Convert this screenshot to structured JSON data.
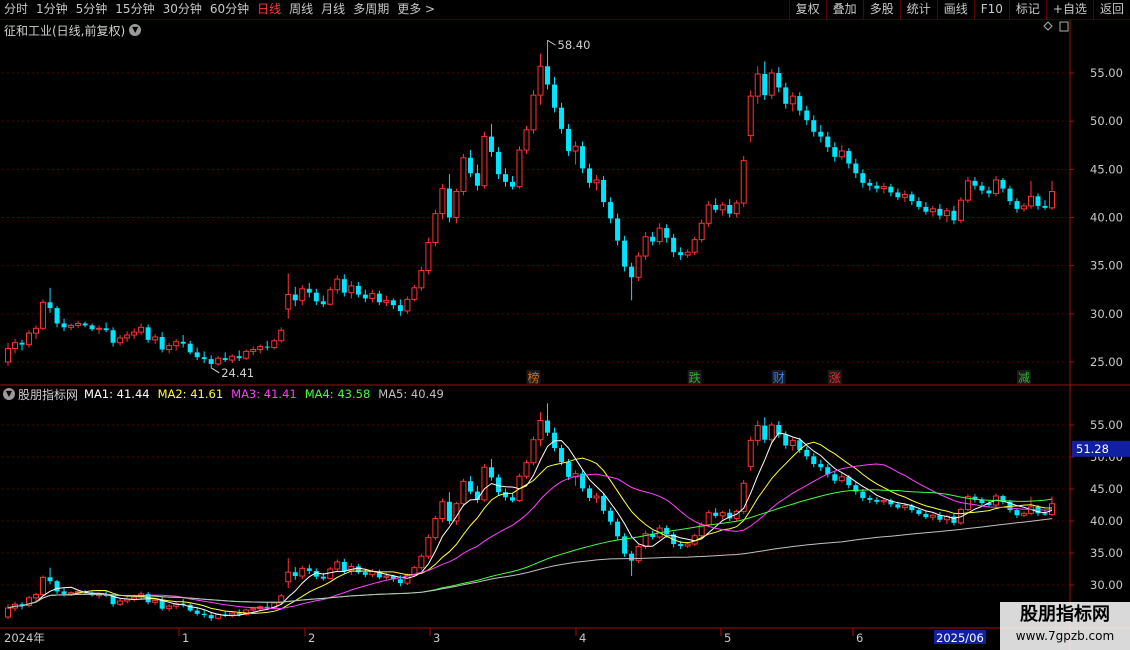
{
  "toolbar": {
    "left": [
      "分时",
      "1分钟",
      "5分钟",
      "15分钟",
      "30分钟",
      "60分钟",
      "日线",
      "周线",
      "月线",
      "多周期",
      "更多 >"
    ],
    "active": "日线",
    "right": [
      "复权",
      "叠加",
      "多股",
      "统计",
      "画线",
      "F10",
      "标记",
      "+自选",
      "返回"
    ]
  },
  "main_panel": {
    "title": "征和工业(日线,前复权)",
    "events": [
      "榜",
      "跌",
      "财",
      "涨",
      "减"
    ]
  },
  "indicator_panel": {
    "name": "股朋指标网",
    "ma": [
      {
        "label": "MA1: 41.44",
        "color": "#ffffff"
      },
      {
        "label": "MA2: 41.61",
        "color": "#ffff40"
      },
      {
        "label": "MA3: 41.41",
        "color": "#ff40ff"
      },
      {
        "label": "MA4: 43.58",
        "color": "#40ff40"
      },
      {
        "label": "MA5: 40.49",
        "color": "#c0c0c0"
      }
    ],
    "current_price_tag": "51.28"
  },
  "colors": {
    "up": "#ff3232",
    "down": "#00e5ff",
    "grid": "#5a0000",
    "axis": "#a01010"
  },
  "watermark": {
    "line1": "股朋指标网",
    "line2": "www.7gpzb.com"
  },
  "chart_data": {
    "type": "candlestick",
    "y_ticks_main": [
      "25.00",
      "30.00",
      "35.00",
      "40.00",
      "45.00",
      "50.00",
      "55.00"
    ],
    "y_ticks_ind": [
      "30.00",
      "35.00",
      "40.00",
      "45.00",
      "50.00",
      "55.00"
    ],
    "x_labels": [
      "2024年",
      "1",
      "2",
      "3",
      "4",
      "5",
      "6",
      "2025/06"
    ],
    "max_label": "58.40",
    "min_label": "24.41",
    "ohlc": [
      [
        25.0,
        27.0,
        24.6,
        26.4
      ],
      [
        26.4,
        27.4,
        25.9,
        27.0
      ],
      [
        27.0,
        27.3,
        26.2,
        26.8
      ],
      [
        26.8,
        28.3,
        26.5,
        28.0
      ],
      [
        28.0,
        28.8,
        27.4,
        28.5
      ],
      [
        28.5,
        31.5,
        28.3,
        31.2
      ],
      [
        31.2,
        32.7,
        30.1,
        30.6
      ],
      [
        30.6,
        30.8,
        28.6,
        29.0
      ],
      [
        29.0,
        29.5,
        28.2,
        28.6
      ],
      [
        28.6,
        29.0,
        28.3,
        28.8
      ],
      [
        28.8,
        29.3,
        28.5,
        29.0
      ],
      [
        29.0,
        29.2,
        28.6,
        28.8
      ],
      [
        28.8,
        29.0,
        28.2,
        28.4
      ],
      [
        28.4,
        28.8,
        27.9,
        28.5
      ],
      [
        28.5,
        29.1,
        28.1,
        28.3
      ],
      [
        28.3,
        28.6,
        26.6,
        27.0
      ],
      [
        27.0,
        27.8,
        26.7,
        27.5
      ],
      [
        27.5,
        28.2,
        27.1,
        27.8
      ],
      [
        27.8,
        28.5,
        27.4,
        28.1
      ],
      [
        28.1,
        29.0,
        27.8,
        28.6
      ],
      [
        28.6,
        28.9,
        27.0,
        27.3
      ],
      [
        27.3,
        27.9,
        26.9,
        27.6
      ],
      [
        27.6,
        28.1,
        26.0,
        26.3
      ],
      [
        26.3,
        27.0,
        25.9,
        26.7
      ],
      [
        26.7,
        27.4,
        26.2,
        27.1
      ],
      [
        27.1,
        27.8,
        26.5,
        26.9
      ],
      [
        26.9,
        27.2,
        25.8,
        26.0
      ],
      [
        26.0,
        26.5,
        25.2,
        25.5
      ],
      [
        25.5,
        26.1,
        24.9,
        25.3
      ],
      [
        25.3,
        25.7,
        24.4,
        24.8
      ],
      [
        24.8,
        25.6,
        24.6,
        25.4
      ],
      [
        25.4,
        26.0,
        25.0,
        25.2
      ],
      [
        25.2,
        25.8,
        24.9,
        25.6
      ],
      [
        25.6,
        26.2,
        25.1,
        25.4
      ],
      [
        25.4,
        26.3,
        25.2,
        26.1
      ],
      [
        26.1,
        26.6,
        25.7,
        26.3
      ],
      [
        26.3,
        26.8,
        25.9,
        26.6
      ],
      [
        26.6,
        27.2,
        26.2,
        26.5
      ],
      [
        26.5,
        27.4,
        26.3,
        27.2
      ],
      [
        27.2,
        28.6,
        27.0,
        28.3
      ],
      [
        30.5,
        34.2,
        29.5,
        32.0
      ],
      [
        32.0,
        32.8,
        30.8,
        31.4
      ],
      [
        31.4,
        33.0,
        30.9,
        32.6
      ],
      [
        32.6,
        33.2,
        31.7,
        32.2
      ],
      [
        32.2,
        32.6,
        30.9,
        31.3
      ],
      [
        31.3,
        31.9,
        30.7,
        31.0
      ],
      [
        31.0,
        32.8,
        30.9,
        32.5
      ],
      [
        32.5,
        34.0,
        32.1,
        33.6
      ],
      [
        33.6,
        34.1,
        31.8,
        32.2
      ],
      [
        32.2,
        33.4,
        31.6,
        32.9
      ],
      [
        32.9,
        33.3,
        31.7,
        32.0
      ],
      [
        32.0,
        32.5,
        31.2,
        31.6
      ],
      [
        31.6,
        32.5,
        31.2,
        32.1
      ],
      [
        32.1,
        32.4,
        30.9,
        31.2
      ],
      [
        31.2,
        31.9,
        30.8,
        31.4
      ],
      [
        31.4,
        31.6,
        30.5,
        30.9
      ],
      [
        30.9,
        31.5,
        29.8,
        30.3
      ],
      [
        30.3,
        31.8,
        30.0,
        31.5
      ],
      [
        31.5,
        33.0,
        31.3,
        32.7
      ],
      [
        32.7,
        34.9,
        32.4,
        34.5
      ],
      [
        34.5,
        37.9,
        34.1,
        37.4
      ],
      [
        37.4,
        40.8,
        37.0,
        40.4
      ],
      [
        40.4,
        43.5,
        39.8,
        43.0
      ],
      [
        43.0,
        44.5,
        39.5,
        40.0
      ],
      [
        40.0,
        43.0,
        39.4,
        42.7
      ],
      [
        42.7,
        46.6,
        42.3,
        46.2
      ],
      [
        46.2,
        47.0,
        44.2,
        44.6
      ],
      [
        44.6,
        45.5,
        42.8,
        43.3
      ],
      [
        43.3,
        48.9,
        43.0,
        48.4
      ],
      [
        48.4,
        49.7,
        46.3,
        46.8
      ],
      [
        46.8,
        47.3,
        44.0,
        44.5
      ],
      [
        44.5,
        45.1,
        43.2,
        43.7
      ],
      [
        43.7,
        44.3,
        42.9,
        43.2
      ],
      [
        43.2,
        47.4,
        43.0,
        47.0
      ],
      [
        47.0,
        49.5,
        46.6,
        49.1
      ],
      [
        49.1,
        53.2,
        48.7,
        52.7
      ],
      [
        52.7,
        57.0,
        51.7,
        55.7
      ],
      [
        55.7,
        58.4,
        53.3,
        53.8
      ],
      [
        53.8,
        54.6,
        50.9,
        51.4
      ],
      [
        51.4,
        51.9,
        48.7,
        49.2
      ],
      [
        49.2,
        49.7,
        46.4,
        46.9
      ],
      [
        46.9,
        47.9,
        45.5,
        47.4
      ],
      [
        47.4,
        47.9,
        44.6,
        45.1
      ],
      [
        45.1,
        45.6,
        43.1,
        43.6
      ],
      [
        43.6,
        44.4,
        42.8,
        43.9
      ],
      [
        43.9,
        44.3,
        41.1,
        41.6
      ],
      [
        41.6,
        42.1,
        39.4,
        39.9
      ],
      [
        39.9,
        40.4,
        37.1,
        37.6
      ],
      [
        37.6,
        38.1,
        34.4,
        34.9
      ],
      [
        34.9,
        35.3,
        31.4,
        33.8
      ],
      [
        33.8,
        36.4,
        33.4,
        36.0
      ],
      [
        36.0,
        38.5,
        35.6,
        38.0
      ],
      [
        38.0,
        38.5,
        37.1,
        37.5
      ],
      [
        37.5,
        39.4,
        37.2,
        38.9
      ],
      [
        38.9,
        39.3,
        37.4,
        37.9
      ],
      [
        37.9,
        38.3,
        35.9,
        36.4
      ],
      [
        36.4,
        36.9,
        35.6,
        36.1
      ],
      [
        36.1,
        36.7,
        35.8,
        36.4
      ],
      [
        36.4,
        38.0,
        36.1,
        37.7
      ],
      [
        37.7,
        39.8,
        37.4,
        39.4
      ],
      [
        39.4,
        41.7,
        39.0,
        41.3
      ],
      [
        41.3,
        42.0,
        40.5,
        40.8
      ],
      [
        40.8,
        41.6,
        40.2,
        41.3
      ],
      [
        41.3,
        41.9,
        40.0,
        40.4
      ],
      [
        40.4,
        41.8,
        40.0,
        41.5
      ],
      [
        41.5,
        46.4,
        41.1,
        45.9
      ],
      [
        48.5,
        53.2,
        47.8,
        52.6
      ],
      [
        52.6,
        55.7,
        51.8,
        54.9
      ],
      [
        54.9,
        56.2,
        52.2,
        52.7
      ],
      [
        52.7,
        55.4,
        52.3,
        55.0
      ],
      [
        55.0,
        55.6,
        53.0,
        53.5
      ],
      [
        53.5,
        54.0,
        51.3,
        51.8
      ],
      [
        51.8,
        53.0,
        51.0,
        52.6
      ],
      [
        52.6,
        53.0,
        50.6,
        51.1
      ],
      [
        51.1,
        51.6,
        49.6,
        50.1
      ],
      [
        50.1,
        50.6,
        48.4,
        48.9
      ],
      [
        48.9,
        49.6,
        47.8,
        48.4
      ],
      [
        48.4,
        48.9,
        46.8,
        47.3
      ],
      [
        47.3,
        47.8,
        45.8,
        46.3
      ],
      [
        46.3,
        47.5,
        46.0,
        46.9
      ],
      [
        46.9,
        47.2,
        45.1,
        45.6
      ],
      [
        45.6,
        46.1,
        44.1,
        44.6
      ],
      [
        44.6,
        45.0,
        43.1,
        43.6
      ],
      [
        43.6,
        44.0,
        42.8,
        43.3
      ],
      [
        43.3,
        43.7,
        42.6,
        43.0
      ],
      [
        43.0,
        43.6,
        42.5,
        43.2
      ],
      [
        43.2,
        43.5,
        42.2,
        42.6
      ],
      [
        42.6,
        43.0,
        41.8,
        42.1
      ],
      [
        42.1,
        42.8,
        41.6,
        42.4
      ],
      [
        42.4,
        42.7,
        41.3,
        41.7
      ],
      [
        41.7,
        42.1,
        40.8,
        41.1
      ],
      [
        41.1,
        41.6,
        40.3,
        40.6
      ],
      [
        40.6,
        41.2,
        40.1,
        40.9
      ],
      [
        40.9,
        41.4,
        39.8,
        40.2
      ],
      [
        40.2,
        41.0,
        39.5,
        40.7
      ],
      [
        40.7,
        41.2,
        39.3,
        39.7
      ],
      [
        39.7,
        42.1,
        39.4,
        41.8
      ],
      [
        41.8,
        44.2,
        41.5,
        43.8
      ],
      [
        43.8,
        44.2,
        42.9,
        43.3
      ],
      [
        43.3,
        43.7,
        42.4,
        42.8
      ],
      [
        42.8,
        43.2,
        42.1,
        42.5
      ],
      [
        42.5,
        44.3,
        42.2,
        43.9
      ],
      [
        43.9,
        44.1,
        42.6,
        43.0
      ],
      [
        43.0,
        43.3,
        41.3,
        41.7
      ],
      [
        41.7,
        42.0,
        40.5,
        40.9
      ],
      [
        40.9,
        41.5,
        40.6,
        41.2
      ],
      [
        41.2,
        43.8,
        40.9,
        42.2
      ],
      [
        42.2,
        42.5,
        40.8,
        41.2
      ],
      [
        41.2,
        41.8,
        40.8,
        41.0
      ],
      [
        41.0,
        43.8,
        40.8,
        42.7
      ]
    ]
  }
}
